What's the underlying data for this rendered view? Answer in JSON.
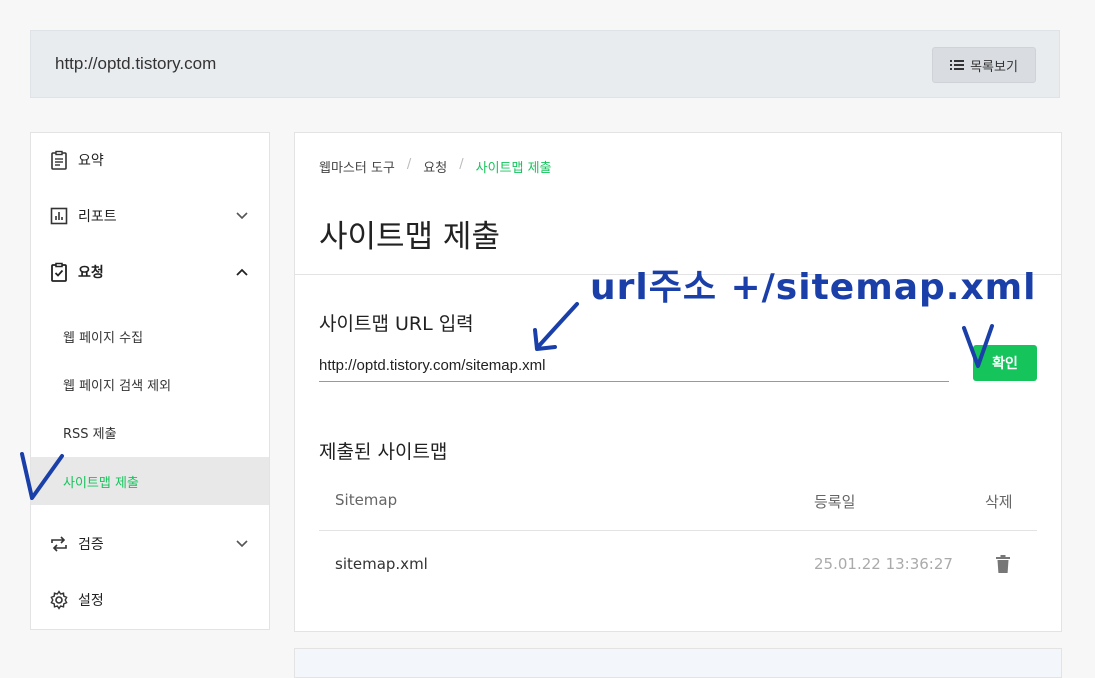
{
  "header": {
    "site_url": "http://optd.tistory.com",
    "list_button_label": "목록보기"
  },
  "sidebar": {
    "items": [
      {
        "label": "요약",
        "icon": "clipboard-icon"
      },
      {
        "label": "리포트",
        "icon": "bar-chart-icon"
      },
      {
        "label": "요청",
        "icon": "clipboard-check-icon"
      },
      {
        "label": "검증",
        "icon": "repeat-icon"
      },
      {
        "label": "설정",
        "icon": "gear-icon"
      }
    ],
    "subitems": [
      {
        "label": "웹 페이지 수집"
      },
      {
        "label": "웹 페이지 검색 제외"
      },
      {
        "label": "RSS 제출"
      },
      {
        "label": "사이트맵 제출"
      }
    ]
  },
  "main": {
    "breadcrumb": [
      "웹마스터 도구",
      "요청",
      "사이트맵 제출"
    ],
    "title": "사이트맵 제출",
    "input_section_label": "사이트맵 URL 입력",
    "input_value": "http://optd.tistory.com/sitemap.xml",
    "confirm_label": "확인",
    "submitted_label": "제출된 사이트맵",
    "table": {
      "headers": [
        "Sitemap",
        "등록일",
        "삭제"
      ],
      "rows": [
        {
          "sitemap": "sitemap.xml",
          "date": "25.01.22 13:36:27"
        }
      ]
    }
  },
  "annotation": {
    "handwritten_text": "url주소 +/sitemap.xml"
  },
  "colors": {
    "accent_green": "#16c45c",
    "annotation_blue": "#1a3fa8"
  }
}
